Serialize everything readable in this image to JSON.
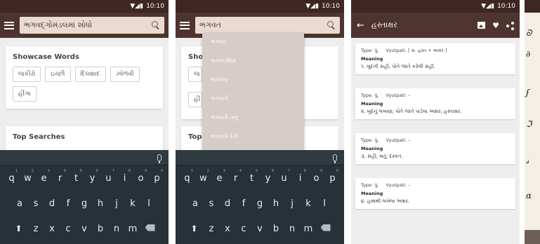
{
  "status": {
    "time": "10:10"
  },
  "screen1": {
    "search_text": "ભગવદ્ગોમંડલમાં શોધો",
    "showcase": {
      "title": "Showcase Words",
      "chips": [
        "જકીરો",
        "ઇચ્છી",
        "દિલશાદ",
        "ઝોળવી",
        "હીંગા"
      ]
    },
    "top_searches": {
      "title": "Top Searches"
    }
  },
  "screen2": {
    "search_text": "ભગવત",
    "behind_labels": {
      "showcase": "Sho",
      "top": "Top",
      "chip1": "જ",
      "chip2": "હીં"
    },
    "suggestions": [
      "ભગવત",
      "ભગવતશિક્ષ",
      "ભગવતા",
      "ભગવતી",
      "ભગવતી તનુ",
      "ભગવતી દેવી"
    ]
  },
  "screen3": {
    "title": "હસ્તાક્ષર",
    "entries": [
      {
        "type": "Type: પું.",
        "vyutpati": "Vyutpati: [ સં. હસ્ત + અક્ષર ]",
        "meaning_label": "Meaning",
        "meaning": "૧. ખુદની સહી; પોતે જાતે કરેલી સહી."
      },
      {
        "type": "Type: પું.",
        "vyutpati": "Vyutpati: –",
        "meaning_label": "Meaning",
        "meaning": "૨. ખુદનું લખાણ; પોતે જાતે પાડેલા અક્ષર; હસ્તાક્ષર."
      },
      {
        "type": "Type: પું.",
        "vyutpati": "Vyutpati: –",
        "meaning_label": "Meaning",
        "meaning": "૩. સહી; મતું; દસ્કત."
      },
      {
        "type": "Type: પું.",
        "vyutpati": "Vyutpati: –",
        "meaning_label": "Meaning",
        "meaning": "૪. હાથથી લખેલા અક્ષર."
      }
    ]
  },
  "keyboard": {
    "row1": [
      "q",
      "w",
      "e",
      "r",
      "t",
      "y",
      "u",
      "i",
      "o",
      "p"
    ],
    "row1_nums": [
      "1",
      "2",
      "3",
      "4",
      "5",
      "6",
      "7",
      "8",
      "9",
      "0"
    ],
    "row2": [
      "a",
      "s",
      "d",
      "f",
      "g",
      "h",
      "j",
      "k",
      "l"
    ],
    "row3": [
      "z",
      "x",
      "c",
      "v",
      "b",
      "n",
      "m"
    ]
  },
  "icons": [
    "menu-icon",
    "search-icon",
    "mic-icon",
    "shift-icon",
    "delete-icon",
    "back-icon",
    "image-icon",
    "heart-icon",
    "share-icon"
  ],
  "colors": {
    "appbar": "#4e342e",
    "statusbar": "#3e2723",
    "keyboard": "#263238",
    "suggest_bg": "#d7ccc8"
  }
}
